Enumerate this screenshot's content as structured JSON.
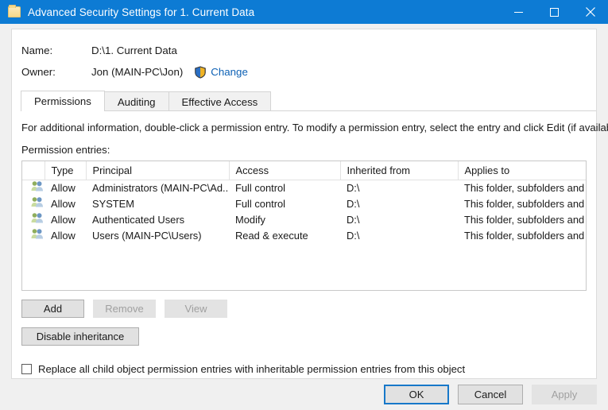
{
  "window": {
    "title": "Advanced Security Settings for 1. Current Data",
    "icon": "folder-icon",
    "minimize_label": "Minimize",
    "maximize_label": "Maximize",
    "close_label": "Close",
    "titlebar_color": "#0d7bd4"
  },
  "info": {
    "name_label": "Name:",
    "name_value": "D:\\1. Current Data",
    "owner_label": "Owner:",
    "owner_value": "Jon (MAIN-PC\\Jon)",
    "change_link": "Change",
    "change_link_color": "#0d61b5",
    "shield_icon": "uac-shield-icon"
  },
  "tabs": [
    {
      "label": "Permissions",
      "active": true
    },
    {
      "label": "Auditing",
      "active": false
    },
    {
      "label": "Effective Access",
      "active": false
    }
  ],
  "main": {
    "instruction": "For additional information, double-click a permission entry. To modify a permission entry, select the entry and click Edit (if available).",
    "entries_label": "Permission entries:"
  },
  "table": {
    "columns": [
      "Type",
      "Principal",
      "Access",
      "Inherited from",
      "Applies to"
    ],
    "rows": [
      {
        "icon": "user-group-icon",
        "type": "Allow",
        "principal": "Administrators (MAIN-PC\\Ad...",
        "access": "Full control",
        "inherited_from": "D:\\",
        "applies_to": "This folder, subfolders and files"
      },
      {
        "icon": "user-group-icon",
        "type": "Allow",
        "principal": "SYSTEM",
        "access": "Full control",
        "inherited_from": "D:\\",
        "applies_to": "This folder, subfolders and files"
      },
      {
        "icon": "user-group-icon",
        "type": "Allow",
        "principal": "Authenticated Users",
        "access": "Modify",
        "inherited_from": "D:\\",
        "applies_to": "This folder, subfolders and files"
      },
      {
        "icon": "user-group-icon",
        "type": "Allow",
        "principal": "Users (MAIN-PC\\Users)",
        "access": "Read & execute",
        "inherited_from": "D:\\",
        "applies_to": "This folder, subfolders and files"
      }
    ]
  },
  "buttons": {
    "add": "Add",
    "remove": "Remove",
    "view": "View",
    "disable_inheritance": "Disable inheritance"
  },
  "checkbox": {
    "label": "Replace all child object permission entries with inheritable permission entries from this object",
    "checked": false
  },
  "footer": {
    "ok": "OK",
    "cancel": "Cancel",
    "apply": "Apply",
    "default_button_border": "#1778c9"
  }
}
